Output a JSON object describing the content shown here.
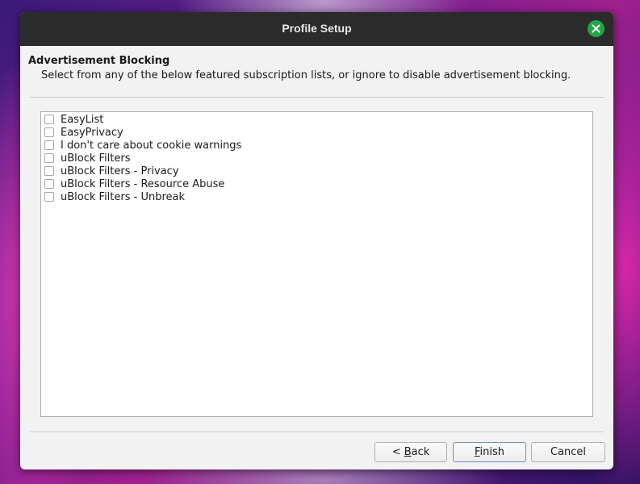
{
  "window": {
    "title": "Profile Setup",
    "close_icon": "close-icon",
    "close_color": "#22a64a"
  },
  "page": {
    "heading": "Advertisement Blocking",
    "description": "Select from any of the below featured subscription lists, or ignore to disable advertisement blocking."
  },
  "subscriptions": [
    {
      "label": "EasyList",
      "checked": false
    },
    {
      "label": "EasyPrivacy",
      "checked": false
    },
    {
      "label": "I don't care about cookie warnings",
      "checked": false
    },
    {
      "label": "uBlock Filters",
      "checked": false
    },
    {
      "label": "uBlock Filters - Privacy",
      "checked": false
    },
    {
      "label": "uBlock Filters - Resource Abuse",
      "checked": false
    },
    {
      "label": "uBlock Filters - Unbreak",
      "checked": false
    }
  ],
  "buttons": {
    "back": {
      "prefix": "< ",
      "mnemonic": "B",
      "rest": "ack"
    },
    "finish": {
      "prefix": "",
      "mnemonic": "F",
      "rest": "inish"
    },
    "cancel": {
      "label": "Cancel"
    }
  }
}
